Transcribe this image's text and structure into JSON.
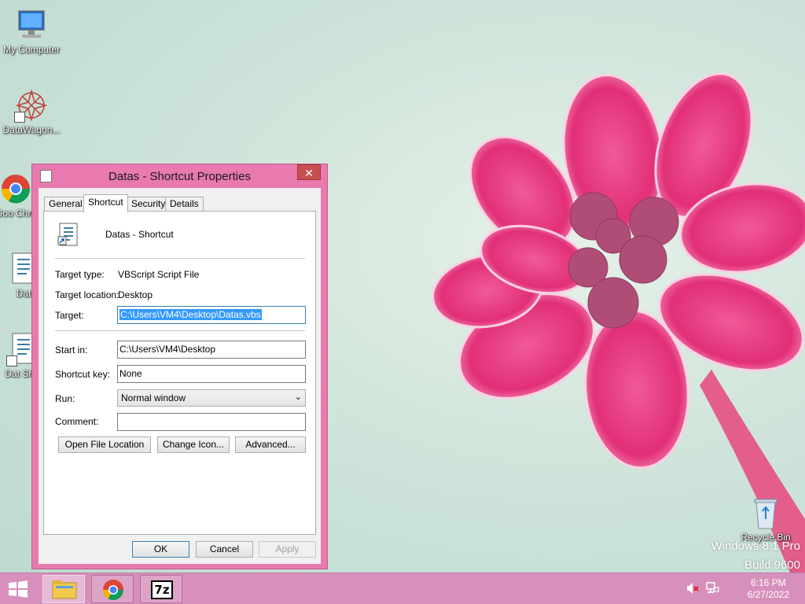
{
  "desktop": {
    "icons": [
      {
        "label": "My Computer"
      },
      {
        "label": "DataWagon..."
      },
      {
        "label": "Goo Chro"
      },
      {
        "label": "Dat"
      },
      {
        "label": "Dat Shor"
      },
      {
        "label": "Recycle Bin"
      }
    ],
    "watermark_line1": "Windows 8.1 Pro",
    "watermark_line2": "Build 9600"
  },
  "dialog": {
    "title": "Datas - Shortcut Properties",
    "close_glyph": "✕",
    "tabs": [
      {
        "label": "General"
      },
      {
        "label": "Shortcut",
        "active": true
      },
      {
        "label": "Security"
      },
      {
        "label": "Details"
      }
    ],
    "shortcut_name": "Datas - Shortcut",
    "fields": {
      "target_type_label": "Target type:",
      "target_type_value": "VBScript Script File",
      "target_location_label": "Target location:",
      "target_location_value": "Desktop",
      "target_label": "Target:",
      "target_value": "C:\\Users\\VM4\\Desktop\\Datas.vbs",
      "start_in_label": "Start in:",
      "start_in_value": "C:\\Users\\VM4\\Desktop",
      "shortcut_key_label": "Shortcut key:",
      "shortcut_key_value": "None",
      "run_label": "Run:",
      "run_value": "Normal window",
      "comment_label": "Comment:",
      "comment_value": ""
    },
    "buttons": {
      "open_file_location": "Open File Location",
      "change_icon": "Change Icon...",
      "advanced": "Advanced...",
      "ok": "OK",
      "cancel": "Cancel",
      "apply": "Apply"
    }
  },
  "taskbar": {
    "items": [
      {
        "name": "file-explorer",
        "active": true
      },
      {
        "name": "chrome",
        "active": false
      },
      {
        "name": "7zip",
        "label": "7z",
        "active": false
      }
    ],
    "clock_time": "6:16 PM",
    "clock_date": "6/27/2022"
  },
  "colors": {
    "dialog_frame": "#e87ab0",
    "taskbar": "#d790bb",
    "selection": "#3399ff",
    "flower": "#e8317c"
  }
}
